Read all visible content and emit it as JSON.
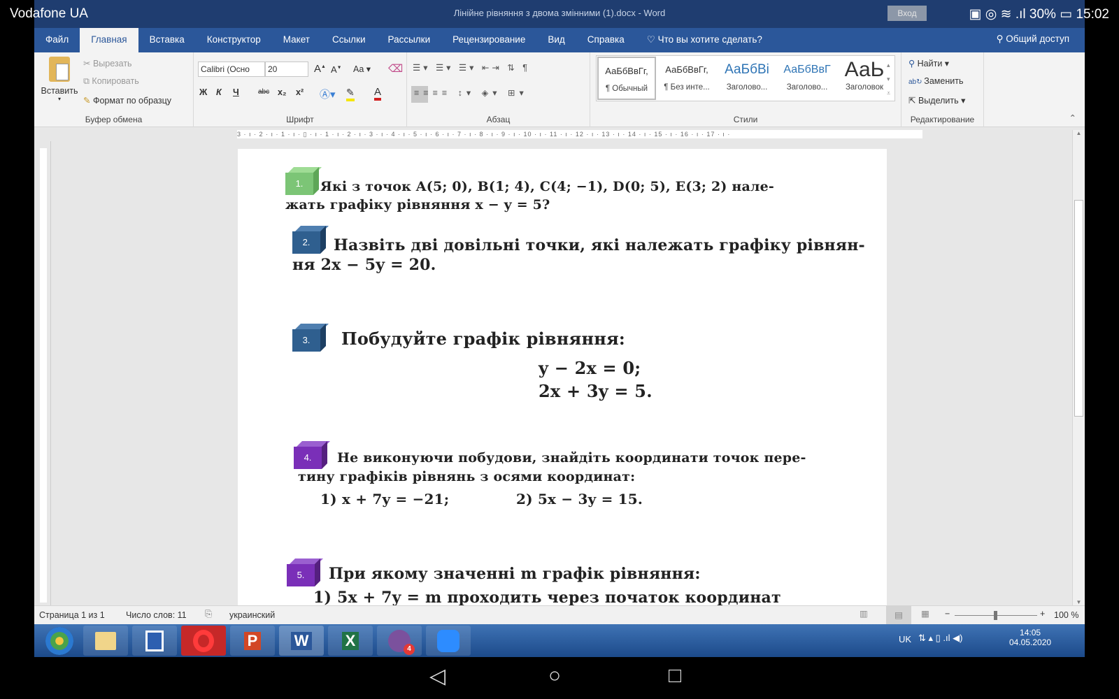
{
  "android": {
    "carrier": "Vodafone UA",
    "battery": "30%",
    "time": "15:02"
  },
  "window": {
    "title": "Лінійне рівняння з двома змінними (1).docx  -  Word",
    "login": "Вход"
  },
  "tabs": [
    "Файл",
    "Главная",
    "Вставка",
    "Конструктор",
    "Макет",
    "Ссылки",
    "Рассылки",
    "Рецензирование",
    "Вид",
    "Справка"
  ],
  "tell_me": "Что вы хотите сделать?",
  "share": "Общий доступ",
  "ribbon": {
    "clipboard": {
      "label": "Буфер обмена",
      "paste": "Вставить",
      "cut": "Вырезать",
      "copy": "Копировать",
      "format_painter": "Формат по образцу"
    },
    "font": {
      "label": "Шрифт",
      "font_name": "Calibri (Осно",
      "font_size": "20",
      "change_case": "Aa",
      "bold": "Ж",
      "italic": "К",
      "underline": "Ч",
      "strike": "abc",
      "sub": "x₂",
      "sup": "x²"
    },
    "paragraph": {
      "label": "Абзац"
    },
    "styles": {
      "label": "Стили",
      "items": [
        {
          "sample": "АаБбВвГг,",
          "name": "¶ Обычный"
        },
        {
          "sample": "АаБбВвГг,",
          "name": "¶ Без инте..."
        },
        {
          "sample": "АаБбВі",
          "name": "Заголово..."
        },
        {
          "sample": "АаБбВвГ",
          "name": "Заголово..."
        },
        {
          "sample": "АаЬ",
          "name": "Заголовок"
        }
      ]
    },
    "editing": {
      "label": "Редактирование",
      "find": "Найти",
      "replace": "Заменить",
      "select": "Выделить"
    }
  },
  "ruler": "3 · ı · 2 · ı · 1 · ı · ▯ · ı · 1 · ı · 2 · ı · 3 · ı · 4 · ı · 5 · ı · 6 · ı · 7 · ı · 8 · ı · 9 · ı · 10 · ı · 11 · ı · 12 · ı · 13 · ı · 14 · ı · 15 · ı · 16 · ı · 17 · ı ·",
  "document": {
    "tasks": [
      {
        "n": "1.",
        "color": "#7cc576",
        "line1": "Які з точок A(5; 0), B(1; 4), C(4; −1), D(0; 5), E(3; 2) нале-",
        "line2": "жать графіку рівняння x − y = 5?"
      },
      {
        "n": "2.",
        "color": "#2f5f8f",
        "line1": "Назвіть дві довільні точки, які належать графіку рівнян-",
        "line2": "ня 2x − 5y = 20."
      },
      {
        "n": "3.",
        "color": "#2f5f8f",
        "line1": "Побудуйте графік рівняння:",
        "eq1": "y − 2x = 0;",
        "eq2": "2x + 3y = 5."
      },
      {
        "n": "4.",
        "color": "#7a2fb8",
        "line1": "Не виконуючи побудови, знайдіть координати точок пере-",
        "line2": "тину графіків рівнянь з осями координат:",
        "sub1": "1) x + 7y = −21;",
        "sub2": "2) 5x − 3y = 15."
      },
      {
        "n": "5.",
        "color": "#7a2fb8",
        "line1": "При якому значенні m графік рівняння:",
        "line2": "1) 5x + 7y = m проходить через початок координат"
      }
    ]
  },
  "status": {
    "page": "Страница 1 из 1",
    "words": "Число слов: 11",
    "language": "украинский",
    "zoom": "100 %",
    "zoom_percent": 100
  },
  "taskbar": {
    "lang": "UK",
    "time": "14:05",
    "date": "04.05.2020",
    "viber_badge": "4"
  }
}
